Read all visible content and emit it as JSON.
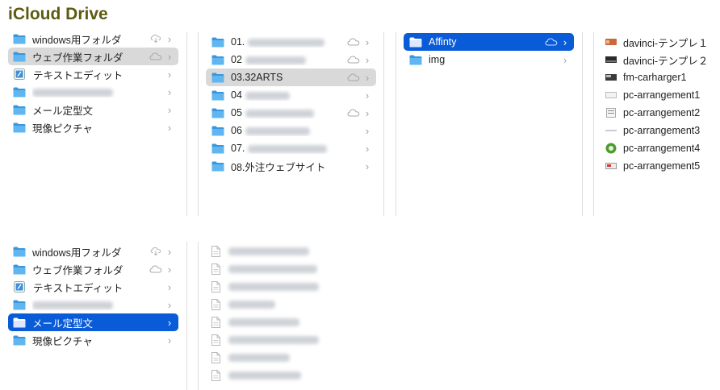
{
  "app_title": "iCloud Drive",
  "top": {
    "sidebar": [
      {
        "label": "windows用フォルダ",
        "cloud": "download",
        "state": ""
      },
      {
        "label": "ウェブ作業フォルダ",
        "cloud": "cloud",
        "state": "gray"
      },
      {
        "label": "テキストエディット",
        "cloud": "",
        "state": "",
        "icon": "textedit"
      },
      {
        "label": "",
        "cloud": "",
        "state": "",
        "blurred": true
      },
      {
        "label": "メール定型文",
        "cloud": "",
        "state": ""
      },
      {
        "label": "現像ピクチャ",
        "cloud": "",
        "state": ""
      }
    ],
    "col2": [
      {
        "label": "01.",
        "cloud": "cloud",
        "state": ""
      },
      {
        "label": "02",
        "cloud": "cloud",
        "state": ""
      },
      {
        "label": "03.32ARTS",
        "cloud": "cloud",
        "state": "gray"
      },
      {
        "label": "04",
        "cloud": "",
        "state": ""
      },
      {
        "label": "05",
        "cloud": "cloud",
        "state": ""
      },
      {
        "label": "06",
        "cloud": "",
        "state": ""
      },
      {
        "label": "07.",
        "cloud": "",
        "state": ""
      },
      {
        "label": "08.外注ウェブサイト",
        "cloud": "",
        "state": ""
      }
    ],
    "col3": [
      {
        "label": "Affinty",
        "cloud": "cloud",
        "state": "blue"
      },
      {
        "label": "img",
        "cloud": "",
        "state": ""
      }
    ],
    "col4": [
      {
        "label": "davinci-テンプレ１",
        "icon": "img-orange"
      },
      {
        "label": "davinci-テンプレ２",
        "icon": "img-dark"
      },
      {
        "label": "fm-carharger1",
        "icon": "img-dark2"
      },
      {
        "label": "pc-arrangement1",
        "icon": "img-light"
      },
      {
        "label": "pc-arrangement2",
        "icon": "img-doc"
      },
      {
        "label": "pc-arrangement3",
        "icon": "img-thin"
      },
      {
        "label": "pc-arrangement4",
        "icon": "img-green"
      },
      {
        "label": "pc-arrangement5",
        "icon": "img-screen"
      }
    ]
  },
  "bottom": {
    "sidebar": [
      {
        "label": "windows用フォルダ",
        "cloud": "download",
        "state": ""
      },
      {
        "label": "ウェブ作業フォルダ",
        "cloud": "cloud",
        "state": ""
      },
      {
        "label": "テキストエディット",
        "cloud": "",
        "state": "",
        "icon": "textedit"
      },
      {
        "label": "",
        "cloud": "",
        "state": "",
        "blurred": true
      },
      {
        "label": "メール定型文",
        "cloud": "",
        "state": "blue"
      },
      {
        "label": "現像ピクチャ",
        "cloud": "",
        "state": ""
      }
    ],
    "files_count_shown": 8
  },
  "colors": {
    "accent": "#0a5bd8",
    "selection_gray": "#d9d9d9",
    "folder": "#4aa8ea",
    "title": "#5d5a12"
  }
}
